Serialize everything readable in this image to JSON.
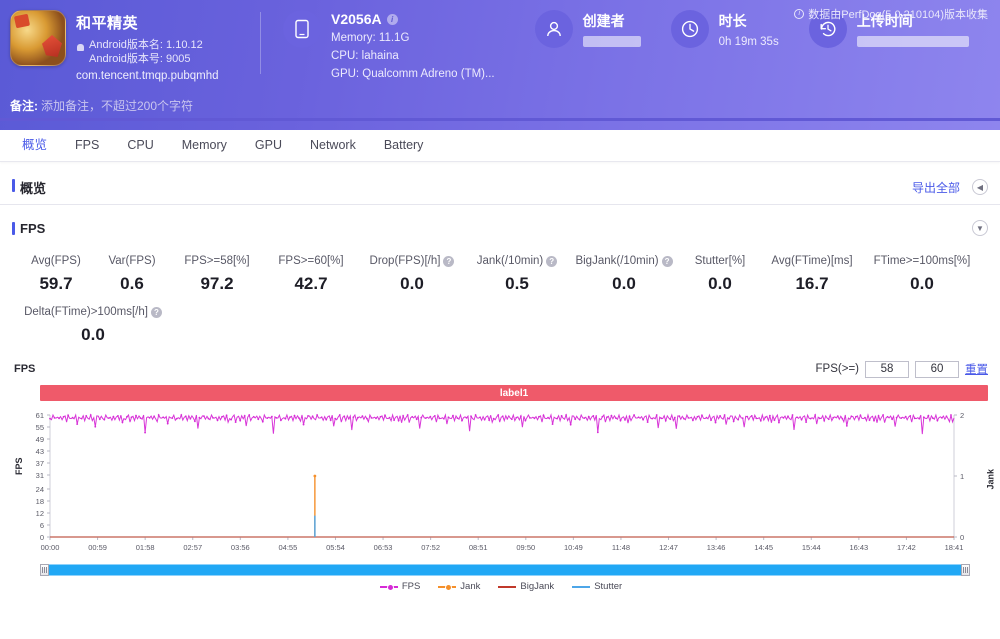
{
  "header": {
    "app": {
      "name": "和平精英",
      "version_name": "Android版本名: 1.10.12",
      "version_code": "Android版本号: 9005",
      "package": "com.tencent.tmqp.pubqmhd"
    },
    "device": {
      "title": "V2056A",
      "memory": "Memory: 11.1G",
      "cpu": "CPU: lahaina",
      "gpu": "GPU: Qualcomm Adreno (TM)..."
    },
    "creator": {
      "title": "创建者",
      "value": ""
    },
    "duration": {
      "title": "时长",
      "value": "0h 19m 35s"
    },
    "upload_time": {
      "title": "上传时间",
      "value": ""
    },
    "perfdog_note": "数据由PerfDog(5.0.210104)版本收集",
    "remark_label": "备注:",
    "remark_placeholder": "添加备注，不超过200个字符"
  },
  "tabs": [
    {
      "label": "概览",
      "active": true
    },
    {
      "label": "FPS",
      "active": false
    },
    {
      "label": "CPU",
      "active": false
    },
    {
      "label": "Memory",
      "active": false
    },
    {
      "label": "GPU",
      "active": false
    },
    {
      "label": "Network",
      "active": false
    },
    {
      "label": "Battery",
      "active": false
    }
  ],
  "overview_panel": {
    "title": "概览",
    "export_label": "导出全部",
    "collapse_icon": "chevron-left-icon"
  },
  "fps_panel": {
    "title": "FPS",
    "collapse_icon": "chevron-down-icon"
  },
  "metrics_row1": [
    {
      "label": "Avg(FPS)",
      "value": "59.7",
      "help": false
    },
    {
      "label": "Var(FPS)",
      "value": "0.6",
      "help": false
    },
    {
      "label": "FPS>=58[%]",
      "value": "97.2",
      "help": false
    },
    {
      "label": "FPS>=60[%]",
      "value": "42.7",
      "help": false
    },
    {
      "label": "Drop(FPS)[/h]",
      "value": "0.0",
      "help": true
    },
    {
      "label": "Jank(/10min)",
      "value": "0.5",
      "help": true
    },
    {
      "label": "BigJank(/10min)",
      "value": "0.0",
      "help": true
    },
    {
      "label": "Stutter[%]",
      "value": "0.0",
      "help": false
    },
    {
      "label": "Avg(FTime)[ms]",
      "value": "16.7",
      "help": false
    },
    {
      "label": "FTime>=100ms[%]",
      "value": "0.0",
      "help": false
    }
  ],
  "metrics_row2": [
    {
      "label": "Delta(FTime)>100ms[/h]",
      "value": "0.0",
      "help": true
    }
  ],
  "chart_controls": {
    "corner_label": "FPS",
    "fps_prefix": "FPS(>=)",
    "threshold_1": "58",
    "threshold_2": "60",
    "reset_label": "重置"
  },
  "label_band": {
    "text": "label1",
    "color": "#ef5a6a"
  },
  "chart_data": {
    "type": "line",
    "title": "FPS",
    "xlabel": "",
    "ylabel": "FPS",
    "y2label": "Jank",
    "grid": false,
    "legend_position": "bottom",
    "ylim": [
      0,
      61
    ],
    "y2lim": [
      0,
      2
    ],
    "yticks": [
      0,
      6,
      12,
      18,
      24,
      31,
      37,
      43,
      49,
      55,
      61
    ],
    "y2ticks": [
      0,
      1,
      2
    ],
    "xticks": [
      "00:00",
      "00:59",
      "01:58",
      "02:57",
      "03:56",
      "04:55",
      "05:54",
      "06:53",
      "07:52",
      "08:51",
      "09:50",
      "10:49",
      "11:48",
      "12:47",
      "13:46",
      "14:45",
      "15:44",
      "16:43",
      "17:42",
      "18:41"
    ],
    "colors": {
      "fps": "#d62ad6",
      "jank": "#f5902b",
      "bigjank": "#c0392b",
      "stutter": "#4da6e8"
    },
    "legend": [
      {
        "name": "FPS",
        "color": "#d62ad6",
        "marker": "dotted-line"
      },
      {
        "name": "Jank",
        "color": "#f5902b",
        "marker": "dotted-line"
      },
      {
        "name": "BigJank",
        "color": "#c0392b",
        "marker": "line"
      },
      {
        "name": "Stutter",
        "color": "#4da6e8",
        "marker": "line"
      }
    ],
    "series": [
      {
        "name": "FPS",
        "axis": "left",
        "description": "Dense per-second FPS samples oscillating between 55 and 61, averaging 59.7, with occasional dips down to ~49-55.",
        "values": [
          60,
          59,
          61,
          59,
          60,
          60,
          59,
          61,
          59,
          60,
          60,
          58,
          61,
          59,
          60,
          60,
          59,
          61,
          57,
          60,
          59,
          60,
          61,
          58,
          60,
          60,
          59,
          61,
          59,
          60,
          55,
          60,
          61,
          59,
          60,
          60,
          59,
          61,
          59,
          60,
          60,
          58,
          61,
          59,
          60,
          60,
          59,
          61,
          57,
          60,
          59,
          60,
          61,
          58,
          60,
          60,
          59,
          61,
          59,
          60,
          60,
          59,
          61,
          53,
          60,
          60,
          59,
          61,
          59,
          60,
          60,
          58,
          61,
          59,
          60,
          60,
          59,
          61,
          57,
          60,
          59,
          60,
          61,
          58,
          60,
          60,
          59,
          61,
          59,
          60,
          60,
          59,
          61,
          59,
          60,
          60,
          58,
          61,
          55,
          60,
          59,
          60,
          61,
          59,
          60,
          60,
          59,
          61,
          59,
          60,
          60,
          58,
          61,
          59,
          60,
          60,
          59,
          61,
          57,
          60,
          59,
          60,
          61,
          58,
          60,
          60,
          59,
          61,
          59,
          60,
          56,
          60,
          61,
          59,
          60,
          60,
          59,
          61,
          59,
          60,
          60,
          58,
          61,
          59,
          60,
          60,
          59,
          61,
          52,
          60,
          59,
          60,
          61,
          58,
          60,
          60,
          59,
          61,
          59,
          60,
          60,
          59,
          61,
          59,
          60,
          60,
          58,
          61,
          57,
          60,
          59,
          60,
          61,
          59,
          60,
          60,
          59,
          61,
          59,
          60,
          60,
          58,
          61,
          59,
          60,
          60,
          59,
          61,
          55,
          60,
          59,
          60,
          61,
          58,
          60,
          60,
          59,
          61,
          59,
          60,
          54,
          60,
          61,
          59,
          60,
          60,
          59,
          61,
          59,
          60,
          60,
          58,
          61,
          59,
          60
        ]
      },
      {
        "name": "Jank",
        "axis": "right",
        "description": "Flat at 0 with a single spike of 1 at approximately 05:50.",
        "spikes": [
          {
            "x": "05:50",
            "value": 1
          }
        ]
      },
      {
        "name": "BigJank",
        "axis": "right",
        "description": "Flat at 0 across the full timeline.",
        "values": []
      },
      {
        "name": "Stutter",
        "axis": "right",
        "description": "Flat at 0 with a small spike of ~0.35 at approximately 05:50.",
        "spikes": [
          {
            "x": "05:50",
            "value": 0.35
          }
        ]
      }
    ]
  }
}
